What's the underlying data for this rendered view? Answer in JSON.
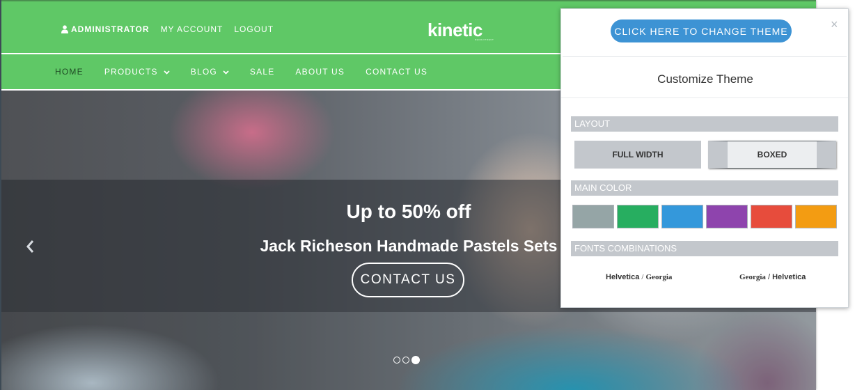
{
  "topbar": {
    "admin_label": "ADMINISTRATOR",
    "my_account_label": "MY ACCOUNT",
    "logout_label": "LOGOUT",
    "logo_text": "kinetic",
    "logo_subtext": "RECRUITMENT"
  },
  "nav": {
    "items": [
      {
        "label": "HOME"
      },
      {
        "label": "PRODUCTS"
      },
      {
        "label": "BLOG"
      },
      {
        "label": "SALE"
      },
      {
        "label": "ABOUT US"
      },
      {
        "label": "CONTACT US"
      }
    ]
  },
  "slider": {
    "title": "Up to 50% off",
    "subtitle": "Jack Richeson Handmade Pastels Sets",
    "cta_label": "CONTACT US",
    "active_dot": 3,
    "dot_count": 3
  },
  "customizer": {
    "change_theme_label": "CLICK HERE TO CHANGE THEME",
    "close_label": "×",
    "title": "Customize Theme",
    "layout_heading": "LAYOUT",
    "layout_options": [
      "FULL WIDTH",
      "BOXED"
    ],
    "selected_layout": "BOXED",
    "main_color_heading": "MAIN COLOR",
    "colors": [
      "#95a5a6",
      "#27ae60",
      "#3498db",
      "#8e44ad",
      "#e74c3c",
      "#f39c12"
    ],
    "fonts_heading": "FONTS COMBINATIONS",
    "font_combos": [
      {
        "primary": "Helvetica",
        "separator": "/",
        "secondary": "Georgia"
      },
      {
        "primary": "Georgia",
        "separator": "/",
        "secondary": "Helvetica"
      }
    ]
  },
  "colors": {
    "header_green": "#5fc866",
    "theme_button_blue": "#3d93d4",
    "panel_gray": "#c3c7cc"
  }
}
